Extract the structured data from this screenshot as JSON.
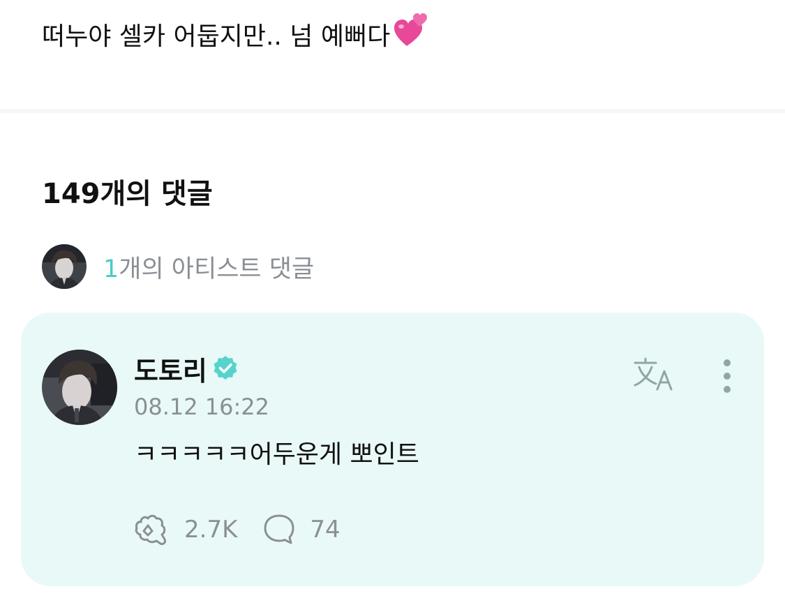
{
  "post": {
    "text": "떠누야 셀카 어둡지만.. 넘 예뻐다",
    "emoji_icon": "two-hearts-icon"
  },
  "comments_header": {
    "count_label": "149개의 댓글"
  },
  "artist_comments": {
    "count": "1",
    "label": "개의 아티스트 댓글"
  },
  "comment": {
    "author": "도토리",
    "verified_icon": "verified-badge-icon",
    "timestamp": "08.12 16:22",
    "text": "ㅋㅋㅋㅋㅋ어두운게 뽀인트",
    "like_count": "2.7K",
    "reply_count": "74",
    "translate_icon": "translate-icon",
    "more_icon": "more-vertical-icon"
  },
  "colors": {
    "accent": "#49cbc6",
    "card_background": "#e9f9f7",
    "muted_text": "#8a8f95",
    "heart": "#e8489a"
  }
}
